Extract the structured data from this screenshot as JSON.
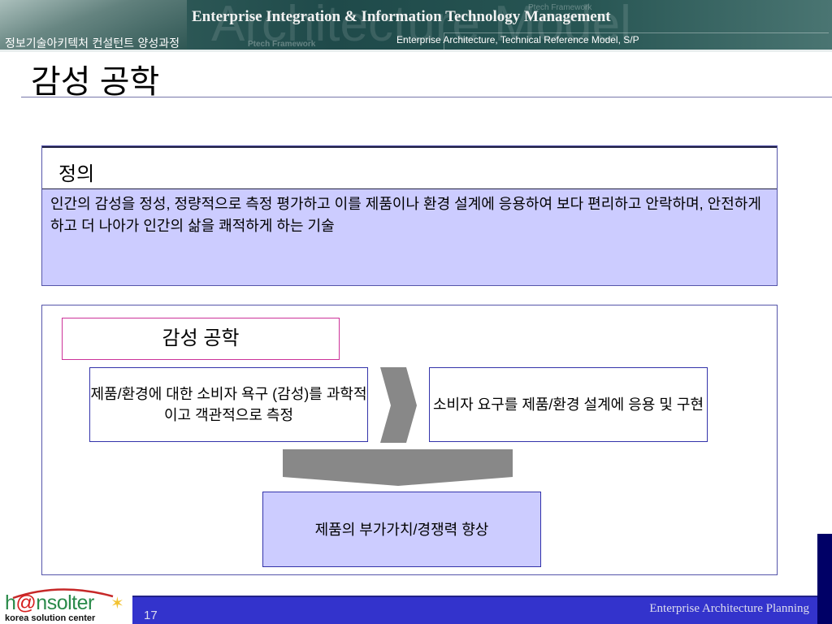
{
  "header": {
    "banner_title": "Enterprise Integration & Information Technology Management",
    "course_name": "정보기술아키텍처 컨설턴트 양성과정",
    "subtitle": "Enterprise Architecture, Technical Reference Model, S/P",
    "watermark": "Architecture Model",
    "ptech_label": "Ptech Framework",
    "ptech_label_2": "Ptech Framework"
  },
  "slide": {
    "title": "감성 공학",
    "definition": {
      "heading": "정의",
      "text": "인간의 감성을 정성, 정량적으로 측정 평가하고 이를 제품이나 환경 설계에 응용하여 보다 편리하고 안락하며, 안전하게 하고 더 나아가 인간의 삶을 쾌적하게 하는 기술"
    },
    "diagram": {
      "title": "감성 공학",
      "left_box": "제품/환경에 대한 소비자 욕구 (감성)를 과학적이고 객관적으로 측정",
      "right_box": "소비자 요구를 제품/환경 설계에 응용 및 구현",
      "result_box": "제품의 부가가치/경쟁력 향상"
    }
  },
  "footer": {
    "page_number": "17",
    "text": "Enterprise Architecture Planning",
    "logo_name_prefix": "h",
    "logo_name_at": "@",
    "logo_name_suffix": "nsolter",
    "logo_tagline": "korea solution center"
  },
  "colors": {
    "accent": "#3333cc",
    "box_fill": "#ccccff",
    "banner": "#1f4a4a"
  }
}
